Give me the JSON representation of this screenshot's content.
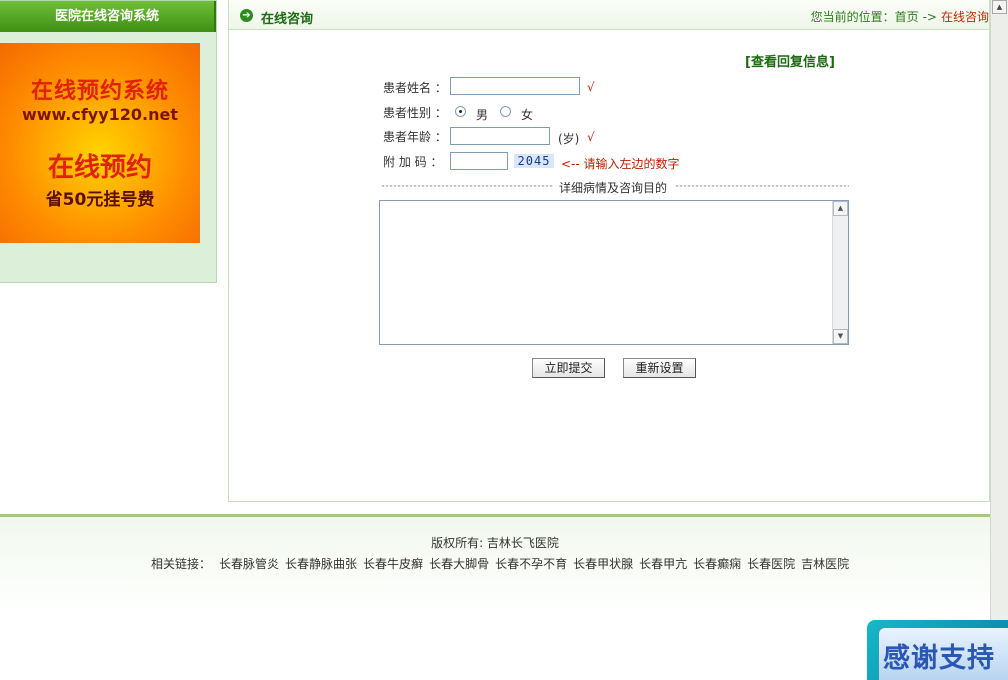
{
  "sidebar": {
    "title": "医院在线咨询系统",
    "banner": {
      "title": "在线预约系统",
      "url": "www.cfyy120.net",
      "subtitle": "在线预约",
      "note": "省50元挂号费"
    }
  },
  "header": {
    "title": "在线咨询",
    "breadcrumb_prefix": "您当前的位置：",
    "breadcrumb_home": "首页",
    "breadcrumb_arrow": "->",
    "breadcrumb_current": "在线咨询"
  },
  "view_reply": "[查看回复信息]",
  "form": {
    "name_label": "患者姓名 ：",
    "gender_label": "患者性别 ：",
    "gender_male": "男",
    "gender_female": "女",
    "age_label": "患者年龄 ：",
    "age_unit": "(岁)",
    "code_label": "附 加 码 ：",
    "captcha": "2045",
    "code_hint": "<-- 请输入左边的数字",
    "required_mark": "√",
    "details_label": "详细病情及咨询目的",
    "submit": "立即提交",
    "reset": "重新设置"
  },
  "footer": {
    "copyright": "版权所有: 吉林长飞医院",
    "links_label": "相关链接：",
    "links": [
      "长春脉管炎",
      "长春静脉曲张",
      "长春牛皮癣",
      "长春大脚骨",
      "长春不孕不育",
      "长春甲状腺",
      "长春甲亢",
      "长春癫痫",
      "长春医院",
      "吉林医院"
    ]
  },
  "badge": {
    "text": "感谢支持"
  }
}
